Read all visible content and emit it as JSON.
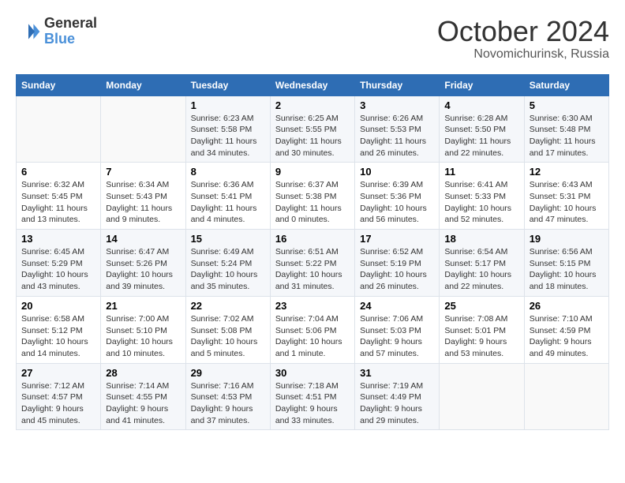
{
  "header": {
    "logo_general": "General",
    "logo_blue": "Blue",
    "month_title": "October 2024",
    "location": "Novomichurinsk, Russia"
  },
  "days_of_week": [
    "Sunday",
    "Monday",
    "Tuesday",
    "Wednesday",
    "Thursday",
    "Friday",
    "Saturday"
  ],
  "weeks": [
    [
      {
        "day": "",
        "content": ""
      },
      {
        "day": "",
        "content": ""
      },
      {
        "day": "1",
        "content": "Sunrise: 6:23 AM\nSunset: 5:58 PM\nDaylight: 11 hours and 34 minutes."
      },
      {
        "day": "2",
        "content": "Sunrise: 6:25 AM\nSunset: 5:55 PM\nDaylight: 11 hours and 30 minutes."
      },
      {
        "day": "3",
        "content": "Sunrise: 6:26 AM\nSunset: 5:53 PM\nDaylight: 11 hours and 26 minutes."
      },
      {
        "day": "4",
        "content": "Sunrise: 6:28 AM\nSunset: 5:50 PM\nDaylight: 11 hours and 22 minutes."
      },
      {
        "day": "5",
        "content": "Sunrise: 6:30 AM\nSunset: 5:48 PM\nDaylight: 11 hours and 17 minutes."
      }
    ],
    [
      {
        "day": "6",
        "content": "Sunrise: 6:32 AM\nSunset: 5:45 PM\nDaylight: 11 hours and 13 minutes."
      },
      {
        "day": "7",
        "content": "Sunrise: 6:34 AM\nSunset: 5:43 PM\nDaylight: 11 hours and 9 minutes."
      },
      {
        "day": "8",
        "content": "Sunrise: 6:36 AM\nSunset: 5:41 PM\nDaylight: 11 hours and 4 minutes."
      },
      {
        "day": "9",
        "content": "Sunrise: 6:37 AM\nSunset: 5:38 PM\nDaylight: 11 hours and 0 minutes."
      },
      {
        "day": "10",
        "content": "Sunrise: 6:39 AM\nSunset: 5:36 PM\nDaylight: 10 hours and 56 minutes."
      },
      {
        "day": "11",
        "content": "Sunrise: 6:41 AM\nSunset: 5:33 PM\nDaylight: 10 hours and 52 minutes."
      },
      {
        "day": "12",
        "content": "Sunrise: 6:43 AM\nSunset: 5:31 PM\nDaylight: 10 hours and 47 minutes."
      }
    ],
    [
      {
        "day": "13",
        "content": "Sunrise: 6:45 AM\nSunset: 5:29 PM\nDaylight: 10 hours and 43 minutes."
      },
      {
        "day": "14",
        "content": "Sunrise: 6:47 AM\nSunset: 5:26 PM\nDaylight: 10 hours and 39 minutes."
      },
      {
        "day": "15",
        "content": "Sunrise: 6:49 AM\nSunset: 5:24 PM\nDaylight: 10 hours and 35 minutes."
      },
      {
        "day": "16",
        "content": "Sunrise: 6:51 AM\nSunset: 5:22 PM\nDaylight: 10 hours and 31 minutes."
      },
      {
        "day": "17",
        "content": "Sunrise: 6:52 AM\nSunset: 5:19 PM\nDaylight: 10 hours and 26 minutes."
      },
      {
        "day": "18",
        "content": "Sunrise: 6:54 AM\nSunset: 5:17 PM\nDaylight: 10 hours and 22 minutes."
      },
      {
        "day": "19",
        "content": "Sunrise: 6:56 AM\nSunset: 5:15 PM\nDaylight: 10 hours and 18 minutes."
      }
    ],
    [
      {
        "day": "20",
        "content": "Sunrise: 6:58 AM\nSunset: 5:12 PM\nDaylight: 10 hours and 14 minutes."
      },
      {
        "day": "21",
        "content": "Sunrise: 7:00 AM\nSunset: 5:10 PM\nDaylight: 10 hours and 10 minutes."
      },
      {
        "day": "22",
        "content": "Sunrise: 7:02 AM\nSunset: 5:08 PM\nDaylight: 10 hours and 5 minutes."
      },
      {
        "day": "23",
        "content": "Sunrise: 7:04 AM\nSunset: 5:06 PM\nDaylight: 10 hours and 1 minute."
      },
      {
        "day": "24",
        "content": "Sunrise: 7:06 AM\nSunset: 5:03 PM\nDaylight: 9 hours and 57 minutes."
      },
      {
        "day": "25",
        "content": "Sunrise: 7:08 AM\nSunset: 5:01 PM\nDaylight: 9 hours and 53 minutes."
      },
      {
        "day": "26",
        "content": "Sunrise: 7:10 AM\nSunset: 4:59 PM\nDaylight: 9 hours and 49 minutes."
      }
    ],
    [
      {
        "day": "27",
        "content": "Sunrise: 7:12 AM\nSunset: 4:57 PM\nDaylight: 9 hours and 45 minutes."
      },
      {
        "day": "28",
        "content": "Sunrise: 7:14 AM\nSunset: 4:55 PM\nDaylight: 9 hours and 41 minutes."
      },
      {
        "day": "29",
        "content": "Sunrise: 7:16 AM\nSunset: 4:53 PM\nDaylight: 9 hours and 37 minutes."
      },
      {
        "day": "30",
        "content": "Sunrise: 7:18 AM\nSunset: 4:51 PM\nDaylight: 9 hours and 33 minutes."
      },
      {
        "day": "31",
        "content": "Sunrise: 7:19 AM\nSunset: 4:49 PM\nDaylight: 9 hours and 29 minutes."
      },
      {
        "day": "",
        "content": ""
      },
      {
        "day": "",
        "content": ""
      }
    ]
  ]
}
